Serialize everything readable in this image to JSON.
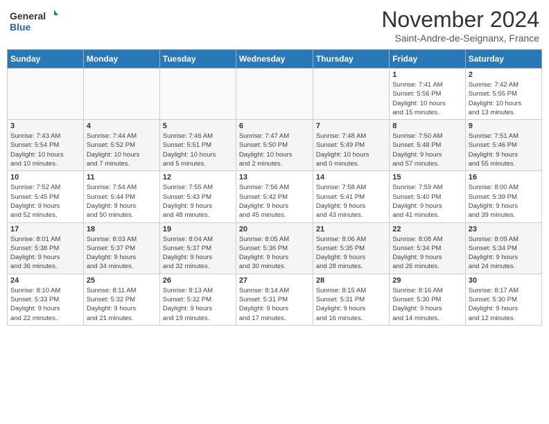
{
  "header": {
    "logo_general": "General",
    "logo_blue": "Blue",
    "month_title": "November 2024",
    "location": "Saint-Andre-de-Seignanx, France"
  },
  "calendar": {
    "headers": [
      "Sunday",
      "Monday",
      "Tuesday",
      "Wednesday",
      "Thursday",
      "Friday",
      "Saturday"
    ],
    "weeks": [
      {
        "days": [
          {
            "num": "",
            "info": ""
          },
          {
            "num": "",
            "info": ""
          },
          {
            "num": "",
            "info": ""
          },
          {
            "num": "",
            "info": ""
          },
          {
            "num": "",
            "info": ""
          },
          {
            "num": "1",
            "info": "Sunrise: 7:41 AM\nSunset: 5:56 PM\nDaylight: 10 hours\nand 15 minutes."
          },
          {
            "num": "2",
            "info": "Sunrise: 7:42 AM\nSunset: 5:55 PM\nDaylight: 10 hours\nand 13 minutes."
          }
        ]
      },
      {
        "days": [
          {
            "num": "3",
            "info": "Sunrise: 7:43 AM\nSunset: 5:54 PM\nDaylight: 10 hours\nand 10 minutes."
          },
          {
            "num": "4",
            "info": "Sunrise: 7:44 AM\nSunset: 5:52 PM\nDaylight: 10 hours\nand 7 minutes."
          },
          {
            "num": "5",
            "info": "Sunrise: 7:46 AM\nSunset: 5:51 PM\nDaylight: 10 hours\nand 5 minutes."
          },
          {
            "num": "6",
            "info": "Sunrise: 7:47 AM\nSunset: 5:50 PM\nDaylight: 10 hours\nand 2 minutes."
          },
          {
            "num": "7",
            "info": "Sunrise: 7:48 AM\nSunset: 5:49 PM\nDaylight: 10 hours\nand 0 minutes."
          },
          {
            "num": "8",
            "info": "Sunrise: 7:50 AM\nSunset: 5:48 PM\nDaylight: 9 hours\nand 57 minutes."
          },
          {
            "num": "9",
            "info": "Sunrise: 7:51 AM\nSunset: 5:46 PM\nDaylight: 9 hours\nand 55 minutes."
          }
        ]
      },
      {
        "days": [
          {
            "num": "10",
            "info": "Sunrise: 7:52 AM\nSunset: 5:45 PM\nDaylight: 9 hours\nand 52 minutes."
          },
          {
            "num": "11",
            "info": "Sunrise: 7:54 AM\nSunset: 5:44 PM\nDaylight: 9 hours\nand 50 minutes."
          },
          {
            "num": "12",
            "info": "Sunrise: 7:55 AM\nSunset: 5:43 PM\nDaylight: 9 hours\nand 48 minutes."
          },
          {
            "num": "13",
            "info": "Sunrise: 7:56 AM\nSunset: 5:42 PM\nDaylight: 9 hours\nand 45 minutes."
          },
          {
            "num": "14",
            "info": "Sunrise: 7:58 AM\nSunset: 5:41 PM\nDaylight: 9 hours\nand 43 minutes."
          },
          {
            "num": "15",
            "info": "Sunrise: 7:59 AM\nSunset: 5:40 PM\nDaylight: 9 hours\nand 41 minutes."
          },
          {
            "num": "16",
            "info": "Sunrise: 8:00 AM\nSunset: 5:39 PM\nDaylight: 9 hours\nand 39 minutes."
          }
        ]
      },
      {
        "days": [
          {
            "num": "17",
            "info": "Sunrise: 8:01 AM\nSunset: 5:38 PM\nDaylight: 9 hours\nand 36 minutes."
          },
          {
            "num": "18",
            "info": "Sunrise: 8:03 AM\nSunset: 5:37 PM\nDaylight: 9 hours\nand 34 minutes."
          },
          {
            "num": "19",
            "info": "Sunrise: 8:04 AM\nSunset: 5:37 PM\nDaylight: 9 hours\nand 32 minutes."
          },
          {
            "num": "20",
            "info": "Sunrise: 8:05 AM\nSunset: 5:36 PM\nDaylight: 9 hours\nand 30 minutes."
          },
          {
            "num": "21",
            "info": "Sunrise: 8:06 AM\nSunset: 5:35 PM\nDaylight: 9 hours\nand 28 minutes."
          },
          {
            "num": "22",
            "info": "Sunrise: 8:08 AM\nSunset: 5:34 PM\nDaylight: 9 hours\nand 26 minutes."
          },
          {
            "num": "23",
            "info": "Sunrise: 8:09 AM\nSunset: 5:34 PM\nDaylight: 9 hours\nand 24 minutes."
          }
        ]
      },
      {
        "days": [
          {
            "num": "24",
            "info": "Sunrise: 8:10 AM\nSunset: 5:33 PM\nDaylight: 9 hours\nand 22 minutes."
          },
          {
            "num": "25",
            "info": "Sunrise: 8:11 AM\nSunset: 5:32 PM\nDaylight: 9 hours\nand 21 minutes."
          },
          {
            "num": "26",
            "info": "Sunrise: 8:13 AM\nSunset: 5:32 PM\nDaylight: 9 hours\nand 19 minutes."
          },
          {
            "num": "27",
            "info": "Sunrise: 8:14 AM\nSunset: 5:31 PM\nDaylight: 9 hours\nand 17 minutes."
          },
          {
            "num": "28",
            "info": "Sunrise: 8:15 AM\nSunset: 5:31 PM\nDaylight: 9 hours\nand 16 minutes."
          },
          {
            "num": "29",
            "info": "Sunrise: 8:16 AM\nSunset: 5:30 PM\nDaylight: 9 hours\nand 14 minutes."
          },
          {
            "num": "30",
            "info": "Sunrise: 8:17 AM\nSunset: 5:30 PM\nDaylight: 9 hours\nand 12 minutes."
          }
        ]
      }
    ]
  }
}
